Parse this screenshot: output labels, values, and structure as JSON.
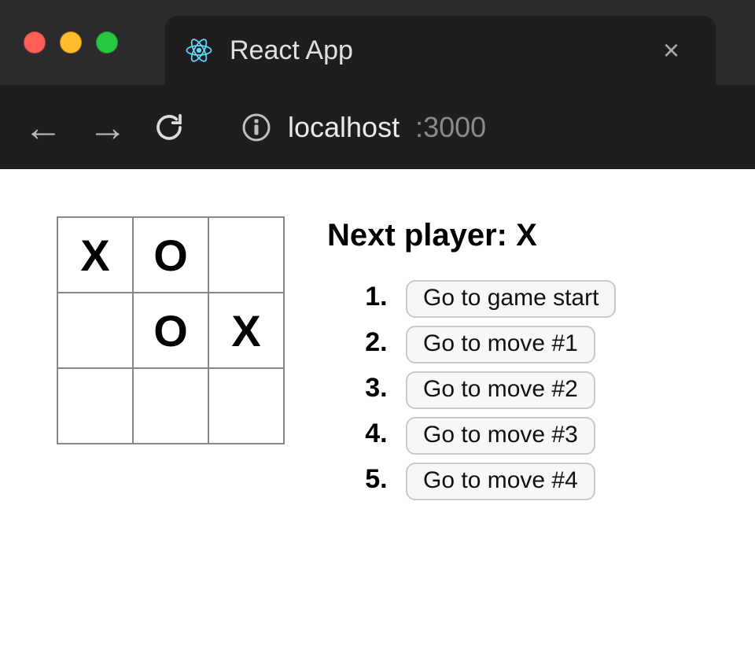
{
  "chrome": {
    "tab_title": "React App",
    "close_glyph": "×",
    "back_glyph": "←",
    "forward_glyph": "→",
    "url_host": "localhost",
    "url_port": ":3000"
  },
  "game": {
    "status": "Next player: X",
    "board": [
      [
        "X",
        "O",
        ""
      ],
      [
        "",
        "O",
        "X"
      ],
      [
        "",
        "",
        ""
      ]
    ],
    "moves": [
      {
        "label": "Go to game start"
      },
      {
        "label": "Go to move #1"
      },
      {
        "label": "Go to move #2"
      },
      {
        "label": "Go to move #3"
      },
      {
        "label": "Go to move #4"
      }
    ]
  }
}
